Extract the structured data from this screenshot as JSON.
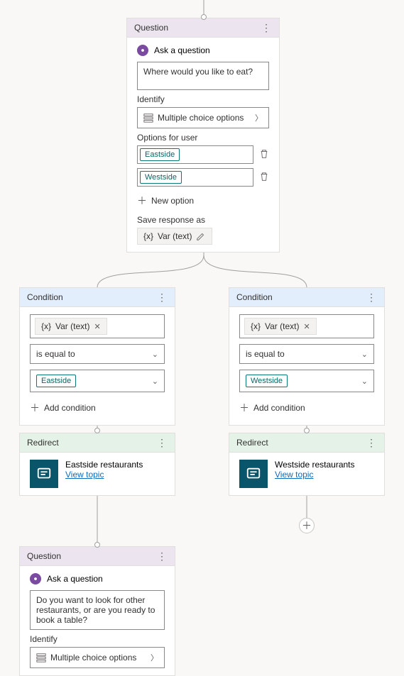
{
  "question1": {
    "header": "Question",
    "ask_label": "Ask a question",
    "prompt_value": "Where would you like to eat?",
    "identify_label": "Identify",
    "identify_value": "Multiple choice options",
    "options_label": "Options for user",
    "option1": "Eastside",
    "option2": "Westside",
    "new_option_label": "New option",
    "save_label": "Save response as",
    "var_name": "Var (text)"
  },
  "condition1": {
    "header": "Condition",
    "var_label": "Var (text)",
    "operator": "is equal to",
    "value": "Eastside",
    "add_condition": "Add condition"
  },
  "condition2": {
    "header": "Condition",
    "var_label": "Var (text)",
    "operator": "is equal to",
    "value": "Westside",
    "add_condition": "Add condition"
  },
  "redirect1": {
    "header": "Redirect",
    "title": "Eastside restaurants",
    "link": "View topic"
  },
  "redirect2": {
    "header": "Redirect",
    "title": "Westside restaurants",
    "link": "View topic"
  },
  "question2": {
    "header": "Question",
    "ask_label": "Ask a question",
    "prompt_value": "Do you want to look for other restaurants, or are you ready to book a table?",
    "identify_label": "Identify",
    "identify_value": "Multiple choice options"
  }
}
